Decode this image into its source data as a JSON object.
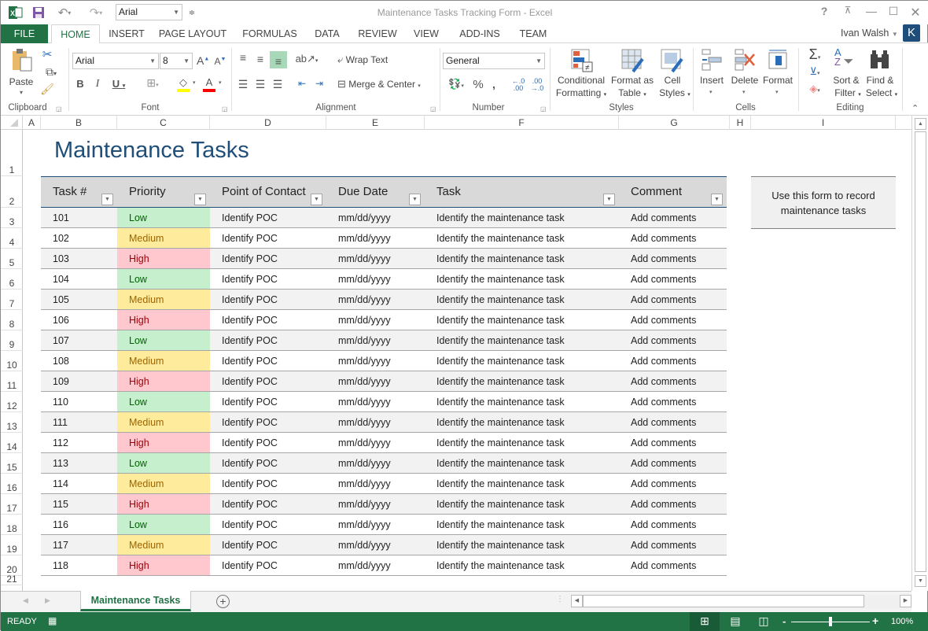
{
  "window": {
    "title": "Maintenance Tasks Tracking Form - Excel",
    "user": "Ivan Walsh",
    "user_initial": "K"
  },
  "qat": {
    "font_box": "Arial"
  },
  "tabs": [
    "FILE",
    "HOME",
    "INSERT",
    "PAGE LAYOUT",
    "FORMULAS",
    "DATA",
    "REVIEW",
    "VIEW",
    "ADD-INS",
    "TEAM"
  ],
  "ribbon": {
    "clipboard": {
      "label": "Clipboard",
      "paste": "Paste"
    },
    "font": {
      "label": "Font",
      "name": "Arial",
      "size": "8"
    },
    "alignment": {
      "label": "Alignment",
      "wrap": "Wrap Text",
      "merge": "Merge & Center"
    },
    "number": {
      "label": "Number",
      "format": "General"
    },
    "styles": {
      "label": "Styles",
      "cond1": "Conditional",
      "cond2": "Formatting",
      "fmt1": "Format as",
      "fmt2": "Table",
      "cell1": "Cell",
      "cell2": "Styles"
    },
    "cells": {
      "label": "Cells",
      "insert": "Insert",
      "delete": "Delete",
      "format": "Format"
    },
    "editing": {
      "label": "Editing",
      "sort1": "Sort &",
      "sort2": "Filter",
      "find1": "Find &",
      "find2": "Select"
    }
  },
  "columns": [
    "A",
    "B",
    "C",
    "D",
    "E",
    "F",
    "G",
    "H",
    "I"
  ],
  "rows": [
    "1",
    "2",
    "3",
    "4",
    "5",
    "6",
    "7",
    "8",
    "9",
    "10",
    "11",
    "12",
    "13",
    "14",
    "15",
    "16",
    "17",
    "18",
    "19",
    "20",
    "21"
  ],
  "sheet": {
    "title": "Maintenance Tasks",
    "headers": [
      "Task #",
      "Priority",
      "Point of Contact",
      "Due Date",
      "Task",
      "Comment"
    ],
    "note": "Use this form to record maintenance tasks",
    "records": [
      {
        "id": "101",
        "priority": "Low",
        "poc": "Identify POC",
        "due": "mm/dd/yyyy",
        "task": "Identify the maintenance task",
        "comment": "Add comments"
      },
      {
        "id": "102",
        "priority": "Medium",
        "poc": "Identify POC",
        "due": "mm/dd/yyyy",
        "task": "Identify the maintenance task",
        "comment": "Add comments"
      },
      {
        "id": "103",
        "priority": "High",
        "poc": "Identify POC",
        "due": "mm/dd/yyyy",
        "task": "Identify the maintenance task",
        "comment": "Add comments"
      },
      {
        "id": "104",
        "priority": "Low",
        "poc": "Identify POC",
        "due": "mm/dd/yyyy",
        "task": "Identify the maintenance task",
        "comment": "Add comments"
      },
      {
        "id": "105",
        "priority": "Medium",
        "poc": "Identify POC",
        "due": "mm/dd/yyyy",
        "task": "Identify the maintenance task",
        "comment": "Add comments"
      },
      {
        "id": "106",
        "priority": "High",
        "poc": "Identify POC",
        "due": "mm/dd/yyyy",
        "task": "Identify the maintenance task",
        "comment": "Add comments"
      },
      {
        "id": "107",
        "priority": "Low",
        "poc": "Identify POC",
        "due": "mm/dd/yyyy",
        "task": "Identify the maintenance task",
        "comment": "Add comments"
      },
      {
        "id": "108",
        "priority": "Medium",
        "poc": "Identify POC",
        "due": "mm/dd/yyyy",
        "task": "Identify the maintenance task",
        "comment": "Add comments"
      },
      {
        "id": "109",
        "priority": "High",
        "poc": "Identify POC",
        "due": "mm/dd/yyyy",
        "task": "Identify the maintenance task",
        "comment": "Add comments"
      },
      {
        "id": "110",
        "priority": "Low",
        "poc": "Identify POC",
        "due": "mm/dd/yyyy",
        "task": "Identify the maintenance task",
        "comment": "Add comments"
      },
      {
        "id": "111",
        "priority": "Medium",
        "poc": "Identify POC",
        "due": "mm/dd/yyyy",
        "task": "Identify the maintenance task",
        "comment": "Add comments"
      },
      {
        "id": "112",
        "priority": "High",
        "poc": "Identify POC",
        "due": "mm/dd/yyyy",
        "task": "Identify the maintenance task",
        "comment": "Add comments"
      },
      {
        "id": "113",
        "priority": "Low",
        "poc": "Identify POC",
        "due": "mm/dd/yyyy",
        "task": "Identify the maintenance task",
        "comment": "Add comments"
      },
      {
        "id": "114",
        "priority": "Medium",
        "poc": "Identify POC",
        "due": "mm/dd/yyyy",
        "task": "Identify the maintenance task",
        "comment": "Add comments"
      },
      {
        "id": "115",
        "priority": "High",
        "poc": "Identify POC",
        "due": "mm/dd/yyyy",
        "task": "Identify the maintenance task",
        "comment": "Add comments"
      },
      {
        "id": "116",
        "priority": "Low",
        "poc": "Identify POC",
        "due": "mm/dd/yyyy",
        "task": "Identify the maintenance task",
        "comment": "Add comments"
      },
      {
        "id": "117",
        "priority": "Medium",
        "poc": "Identify POC",
        "due": "mm/dd/yyyy",
        "task": "Identify the maintenance task",
        "comment": "Add comments"
      },
      {
        "id": "118",
        "priority": "High",
        "poc": "Identify POC",
        "due": "mm/dd/yyyy",
        "task": "Identify the maintenance task",
        "comment": "Add comments"
      }
    ]
  },
  "priority_colors": {
    "Low": {
      "bg": "#c6efce",
      "fg": "#006100"
    },
    "Medium": {
      "bg": "#ffeb9c",
      "fg": "#9c6500"
    },
    "High": {
      "bg": "#ffc7ce",
      "fg": "#9c0006"
    }
  },
  "sheet_tab": "Maintenance Tasks",
  "status": {
    "mode": "READY",
    "zoom": "100%"
  },
  "colors": {
    "accent": "#217346",
    "title": "#1f4e79"
  }
}
